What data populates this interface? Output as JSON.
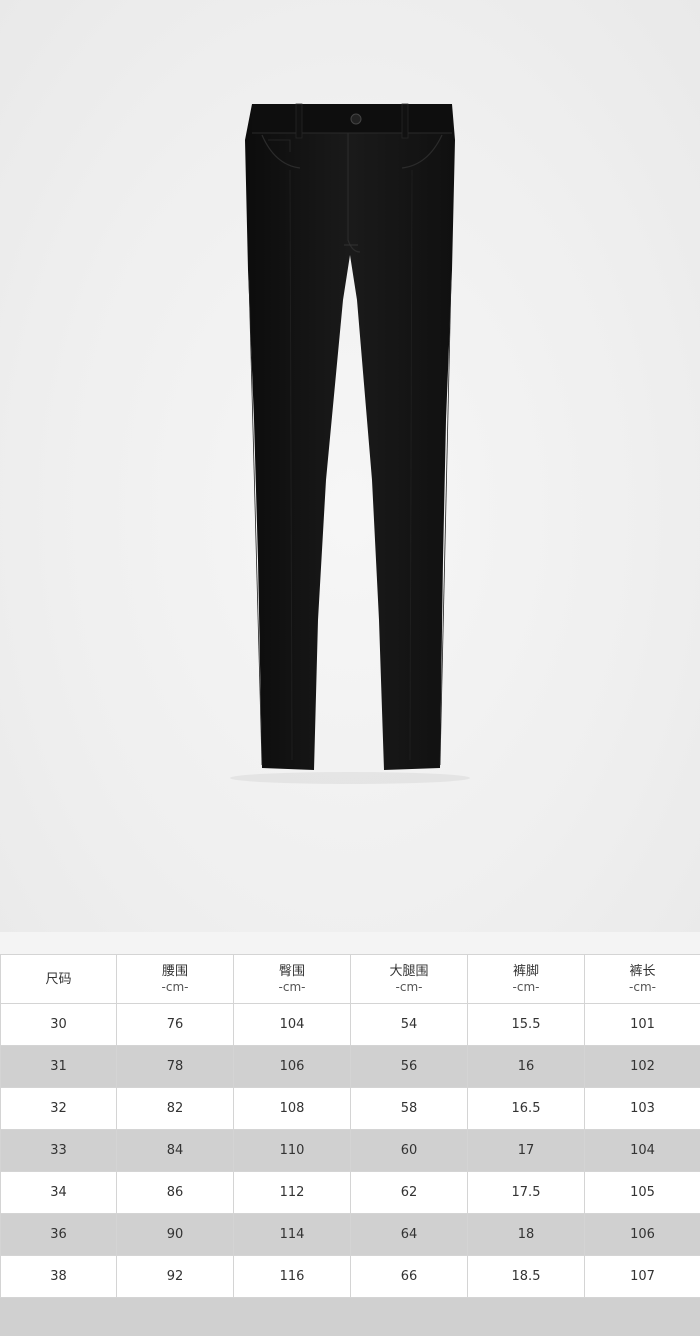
{
  "product_image": {
    "subject": "black-trousers",
    "background_color": "#efefef",
    "garment_color": "#141414"
  },
  "size_chart": {
    "columns": [
      {
        "label": "尺码",
        "unit": ""
      },
      {
        "label": "腰围",
        "unit": "-cm-"
      },
      {
        "label": "臀围",
        "unit": "-cm-"
      },
      {
        "label": "大腿围",
        "unit": "-cm-"
      },
      {
        "label": "裤脚",
        "unit": "-cm-"
      },
      {
        "label": "裤长",
        "unit": "-cm-"
      }
    ],
    "rows": [
      [
        "30",
        "76",
        "104",
        "54",
        "15.5",
        "101"
      ],
      [
        "31",
        "78",
        "106",
        "56",
        "16",
        "102"
      ],
      [
        "32",
        "82",
        "108",
        "58",
        "16.5",
        "103"
      ],
      [
        "33",
        "84",
        "110",
        "60",
        "17",
        "104"
      ],
      [
        "34",
        "86",
        "112",
        "62",
        "17.5",
        "105"
      ],
      [
        "36",
        "90",
        "114",
        "64",
        "18",
        "106"
      ],
      [
        "38",
        "92",
        "116",
        "66",
        "18.5",
        "107"
      ]
    ],
    "alt_row_color": "#d0d0d0"
  }
}
